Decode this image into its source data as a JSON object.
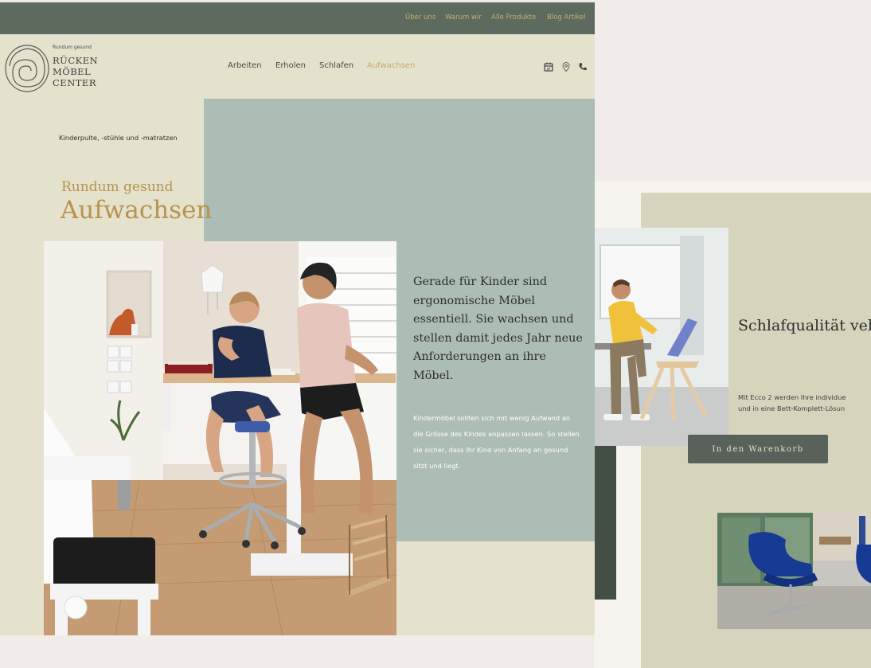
{
  "top_nav": {
    "about": "Über uns",
    "why_us": "Warum wir",
    "all_products": "Alle Produkte",
    "blog": "Blog Artikel"
  },
  "logo": {
    "tagline": "Rundum gesund",
    "line1": "RÜCKEN",
    "line2": "MÖBEL",
    "line3": "CENTER"
  },
  "main_nav": {
    "items": [
      "Arbeiten",
      "Erholen",
      "Schlafen",
      "Aufwachsen"
    ],
    "active": "Aufwachsen"
  },
  "header_icons": [
    "calendar-icon",
    "location-pin-icon",
    "phone-icon"
  ],
  "hero": {
    "breadcrumb": "Kinderpulte, -stühle und -matratzen",
    "kicker": "Rundum gesund",
    "title": "Aufwachsen"
  },
  "intro": {
    "lead": "Gerade für Kinder sind ergonomische Möbel essentiell. Sie wachsen und stellen damit jedes Jahr neue Anforderungen an ihre Möbel.",
    "body": "Kindermöbel sollten sich mit wenig Aufwand an die Grösse des Kindes anpassen lassen. So stellen sie sicher, dass Ihr Kind von Anfang an gesund sitzt und liegt."
  },
  "secondary_page": {
    "headline": "Schlafqualität vebessern mit der idealen Matratze.",
    "body_line1": "Mit Ecco 2 werden Ihre individue",
    "body_line2": "und in eine Bett-Komplett-Lösun",
    "cart_button": "In den Warenkorb"
  },
  "colors": {
    "topbar": "#5c6b5d",
    "page_bg": "#e4e2cc",
    "sage": "#acbdb5",
    "gold": "#b8924f",
    "button": "#58625a",
    "back_beige": "#d7d4bd",
    "canvas": "#f1ecea"
  }
}
